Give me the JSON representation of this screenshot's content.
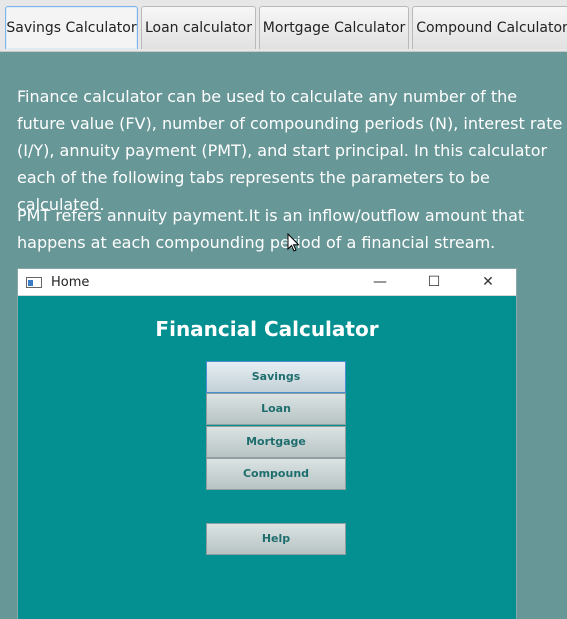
{
  "tabs": [
    {
      "label": "Savings Calculator",
      "active": true
    },
    {
      "label": "Loan calculator",
      "active": false
    },
    {
      "label": "Mortgage Calculator",
      "active": false
    },
    {
      "label": "Compound Calculator",
      "active": false
    }
  ],
  "content": {
    "para1": "Finance calculator can be used to calculate any number of the  future value (FV), number of compounding periods (N), interest rate (I/Y), annuity payment (PMT), and start principal. In this calculator each of the following tabs represents the parameters to be calculated.",
    "para2": "PMT refers annuity payment.It is an inflow/outflow amount that happens at each compounding period of a financial stream."
  },
  "window": {
    "title": "Home",
    "minimize_icon": "—",
    "maximize_icon": "☐",
    "close_icon": "✕",
    "heading": "Financial Calculator",
    "buttons": {
      "savings": "Savings",
      "loan": "Loan",
      "mortgage": "Mortgage",
      "compound": "Compound",
      "help": "Help"
    }
  },
  "colors": {
    "page_background": "#689797",
    "window_background": "#049090",
    "text": "#ffffff"
  }
}
